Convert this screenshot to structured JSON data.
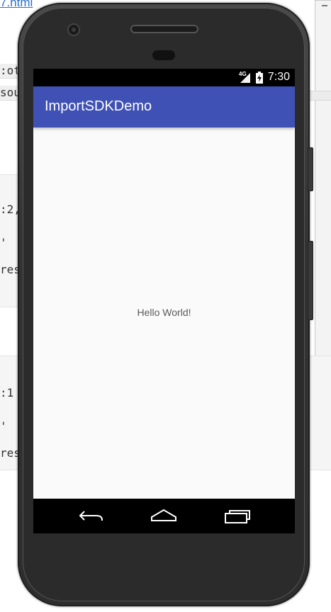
{
  "background": {
    "link_text": "7.html",
    "code_lines": [
      ":ot",
      "sou",
      ":2,",
      "'",
      "res",
      ":1",
      "'",
      "res"
    ]
  },
  "device": {
    "status_bar": {
      "network": "4G",
      "time": "7:30"
    },
    "app_bar": {
      "title": "ImportSDKDemo"
    },
    "content": {
      "text": "Hello World!"
    },
    "nav_bar": {
      "icons": [
        "back-icon",
        "home-icon",
        "recents-icon"
      ]
    }
  },
  "colors": {
    "app_bar": "#3f51b5",
    "screen_background": "#fafafa",
    "system_bars": "#000000"
  }
}
